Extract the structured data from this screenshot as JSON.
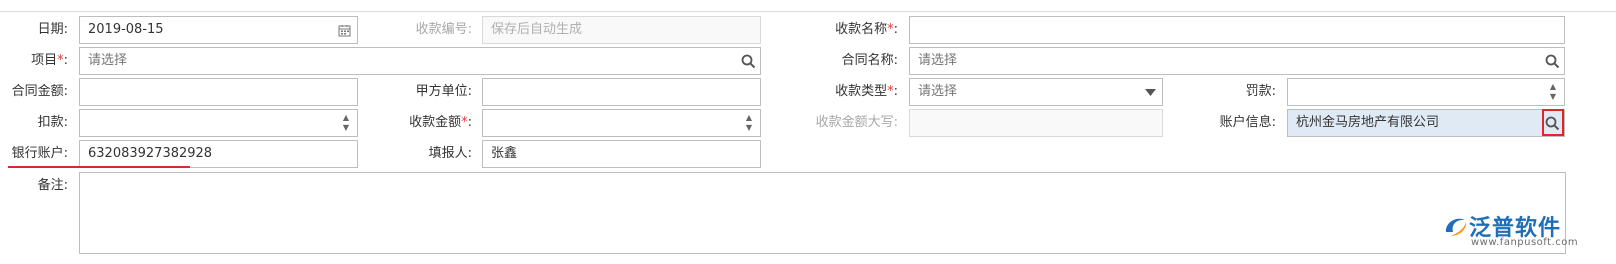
{
  "form": {
    "date": {
      "label": "日期:",
      "value": "2019-08-15"
    },
    "receipt_no": {
      "label": "收款编号:",
      "placeholder": "保存后自动生成"
    },
    "receipt_name": {
      "label": "收款名称",
      "req": "*",
      "colon": ":",
      "value": ""
    },
    "project": {
      "label": "项目",
      "req": "*",
      "colon": ":",
      "placeholder": "请选择"
    },
    "contract_name": {
      "label": "合同名称:",
      "placeholder": "请选择"
    },
    "contract_amount": {
      "label": "合同金额:",
      "value": ""
    },
    "party_a": {
      "label": "甲方单位:",
      "value": ""
    },
    "receipt_type": {
      "label": "收款类型",
      "req": "*",
      "colon": ":",
      "placeholder": "请选择"
    },
    "penalty": {
      "label": "罚款:",
      "value": ""
    },
    "deduction": {
      "label": "扣款:",
      "value": ""
    },
    "receipt_amount": {
      "label": "收款金额",
      "req": "*",
      "colon": ":",
      "value": ""
    },
    "receipt_amount_upper": {
      "label": "收款金额大写:",
      "value": ""
    },
    "account_info": {
      "label": "账户信息:",
      "value": "杭州金马房地产有限公司"
    },
    "bank_account": {
      "label": "银行账户:",
      "value": "632083927382928"
    },
    "reporter": {
      "label": "填报人:",
      "value": "张鑫"
    },
    "remarks": {
      "label": "备注:",
      "value": ""
    }
  },
  "logo": {
    "text": "泛普软件",
    "url": "www.fanpusoft.com"
  },
  "colors": {
    "accent": "#1f6fb8",
    "highlight": "#e0262a",
    "selected_bg": "#dfeaf5"
  },
  "icons": {
    "date": "calendar-icon",
    "search": "search-icon",
    "dropdown": "chevron-down-icon",
    "spinner": "spinner-arrows-icon"
  }
}
